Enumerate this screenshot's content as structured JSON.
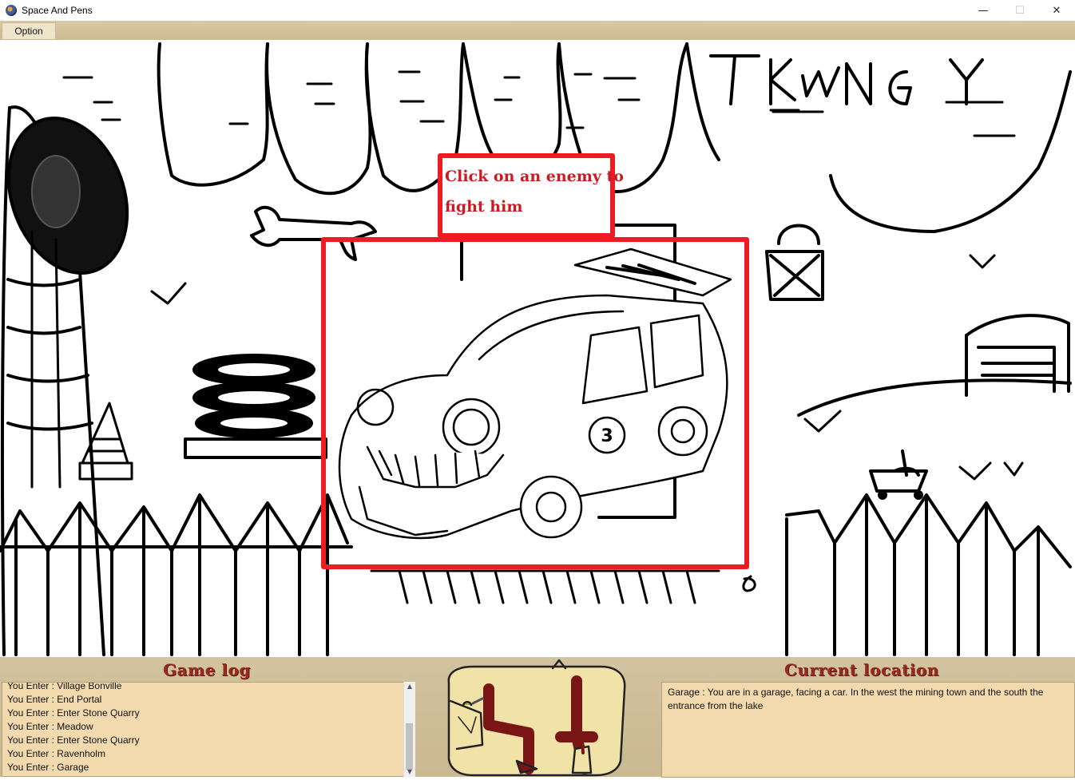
{
  "window": {
    "title": "Space And Pens",
    "minimize": "—",
    "maximize": "☐",
    "close": "✕"
  },
  "menu": {
    "option_label": "Option"
  },
  "scene": {
    "sign_text": "TKENGY",
    "hint": {
      "line1": "Click on an enemy to",
      "line2": "fight him"
    },
    "enemy_name": "enemy-car",
    "car_number": "3",
    "highlight_color": "#ed1c24"
  },
  "game_log": {
    "title": "Game log",
    "entries": [
      "You Enter : Village Bonville",
      "You Enter : End Portal",
      "You Enter : Enter Stone Quarry",
      "You Enter : Meadow",
      "You Enter : Enter Stone Quarry",
      "You Enter : Ravenholm",
      "You Enter : Garage"
    ]
  },
  "current_location": {
    "title": "Current location",
    "text": "Garage : You are in a garage, facing a car. In the west the mining town and the south the entrance from the lake"
  }
}
